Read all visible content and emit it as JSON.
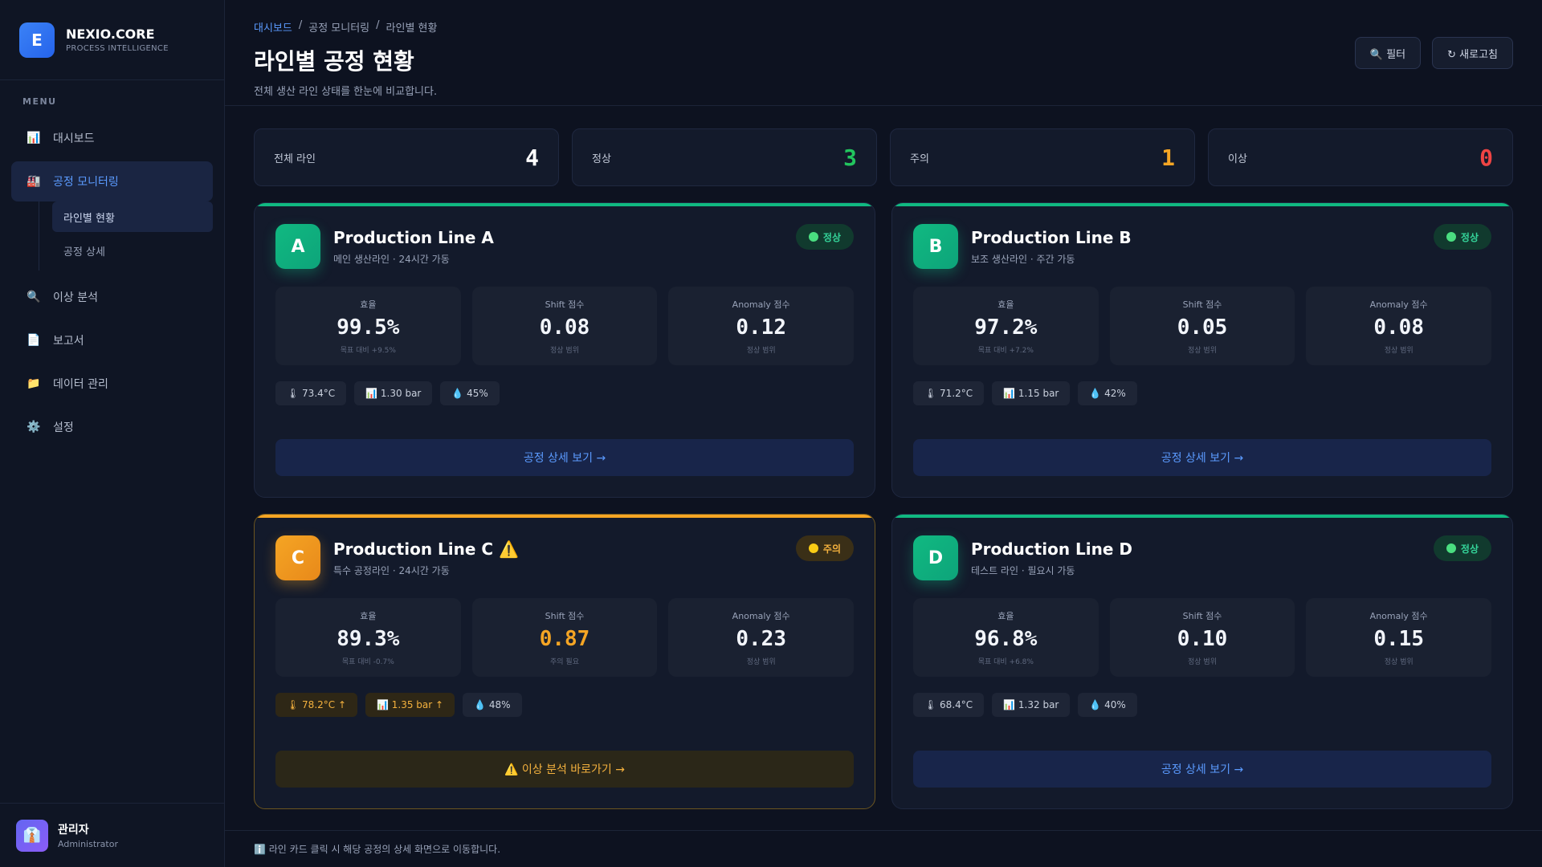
{
  "brand": {
    "logo_letter": "E",
    "name": "NEXIO.CORE",
    "subtitle": "PROCESS INTELLIGENCE"
  },
  "sidebar": {
    "menu_label": "MENU",
    "items": [
      {
        "icon": "📊",
        "icon_name": "bar-chart-icon",
        "label": "대시보드"
      },
      {
        "icon": "🏭",
        "icon_name": "factory-icon",
        "label": "공정 모니터링"
      },
      {
        "icon": "🔍",
        "icon_name": "search-icon",
        "label": "이상 분석"
      },
      {
        "icon": "📄",
        "icon_name": "document-icon",
        "label": "보고서"
      },
      {
        "icon": "📁",
        "icon_name": "folder-icon",
        "label": "데이터 관리"
      },
      {
        "icon": "⚙️",
        "icon_name": "gear-icon",
        "label": "설정"
      }
    ],
    "submenu": [
      {
        "label": "라인별 현황"
      },
      {
        "label": "공정 상세"
      }
    ]
  },
  "user": {
    "avatar": "👔",
    "name": "관리자",
    "role": "Administrator"
  },
  "header": {
    "breadcrumb": [
      "대시보드",
      "공정 모니터링",
      "라인별 현황"
    ],
    "separator": "/",
    "title": "라인별 공정 현황",
    "subtitle": "전체 생산 라인 상태를 한눈에 비교합니다.",
    "filter_label": "🔍 필터",
    "refresh_label": "↻ 새로고침"
  },
  "stats": [
    {
      "label": "전체 라인",
      "value": "4",
      "color": "#ffffff"
    },
    {
      "label": "정상",
      "value": "3",
      "color": "#22c55e"
    },
    {
      "label": "주의",
      "value": "1",
      "color": "#f5a524"
    },
    {
      "label": "이상",
      "value": "0",
      "color": "#ef4444"
    }
  ],
  "metric_labels": {
    "efficiency": "효율",
    "shift": "Shift 점수",
    "anomaly": "Anomaly 점수"
  },
  "lines": [
    {
      "letter": "A",
      "title": "Production Line A",
      "subtitle": "메인 생산라인 · 24시간 가동",
      "status": "정상",
      "state": "normal",
      "efficiency": "99.5%",
      "efficiency_note": "목표 대비 +9.5%",
      "shift": "0.08",
      "shift_note": "정상 범위",
      "anomaly": "0.12",
      "anomaly_note": "정상 범위",
      "temp": "🌡 73.4°C",
      "pressure": "📊 1.30 bar",
      "humidity": "💧 45%",
      "action": "공정 상세 보기 →"
    },
    {
      "letter": "B",
      "title": "Production Line B",
      "subtitle": "보조 생산라인 · 주간 가동",
      "status": "정상",
      "state": "normal",
      "efficiency": "97.2%",
      "efficiency_note": "목표 대비 +7.2%",
      "shift": "0.05",
      "shift_note": "정상 범위",
      "anomaly": "0.08",
      "anomaly_note": "정상 범위",
      "temp": "🌡 71.2°C",
      "pressure": "📊 1.15 bar",
      "humidity": "💧 42%",
      "action": "공정 상세 보기 →"
    },
    {
      "letter": "C",
      "title": "Production Line C ⚠️",
      "subtitle": "특수 공정라인 · 24시간 가동",
      "status": "주의",
      "state": "warn",
      "efficiency": "89.3%",
      "efficiency_note": "목표 대비 -0.7%",
      "shift": "0.87",
      "shift_note": "주의 필요",
      "anomaly": "0.23",
      "anomaly_note": "정상 범위",
      "temp": "🌡 78.2°C ↑",
      "pressure": "📊 1.35 bar ↑",
      "humidity": "💧 48%",
      "action": "⚠️ 이상 분석 바로가기 →"
    },
    {
      "letter": "D",
      "title": "Production Line D",
      "subtitle": "테스트 라인 · 필요시 가동",
      "status": "정상",
      "state": "normal",
      "efficiency": "96.8%",
      "efficiency_note": "목표 대비 +6.8%",
      "shift": "0.10",
      "shift_note": "정상 범위",
      "anomaly": "0.15",
      "anomaly_note": "정상 범위",
      "temp": "🌡 68.4°C",
      "pressure": "📊 1.32 bar",
      "humidity": "💧 40%",
      "action": "공정 상세 보기 →"
    }
  ],
  "colors": {
    "normal": "#10b981",
    "warn": "#f5a524",
    "accent": "#5b9bff"
  },
  "footer_note": "ℹ️ 라인 카드 클릭 시 해당 공정의 상세 화면으로 이동합니다."
}
